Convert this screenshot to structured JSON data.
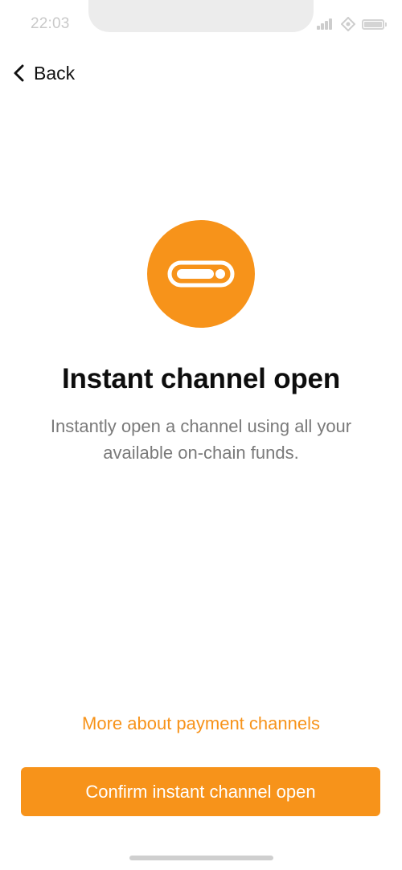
{
  "status_bar": {
    "time": "22:03",
    "icons": [
      "signal-icon",
      "wifi-icon",
      "battery-icon"
    ]
  },
  "nav": {
    "back_label": "Back",
    "back_icon": "chevron-left-icon"
  },
  "hero": {
    "icon": "payment-channel-icon",
    "color": "#f7931a"
  },
  "title": "Instant channel open",
  "description": "Instantly open a channel using all your available on-chain funds.",
  "more_link": "More about payment channels",
  "confirm_button": "Confirm instant channel open",
  "colors": {
    "accent": "#f7931a",
    "text_primary": "#0d0d0d",
    "text_secondary": "#7a7a7a",
    "background": "#ffffff"
  }
}
